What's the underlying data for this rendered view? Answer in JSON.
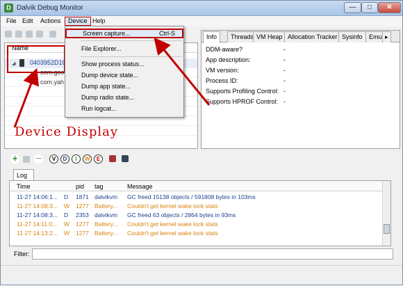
{
  "window": {
    "title": "Dalvik Debug Monitor",
    "min_glyph": "—",
    "max_glyph": "□",
    "close_glyph": "✕",
    "app_icon_glyph": "D"
  },
  "menubar": {
    "items": [
      "File",
      "Edit",
      "Actions",
      "Device",
      "Help"
    ]
  },
  "device_panel": {
    "column_header": "Name",
    "device_serial": "0403952D10",
    "expand_glyph": "◢",
    "apps": [
      "com.goo",
      "com.yah"
    ]
  },
  "device_menu": {
    "items": [
      {
        "label": "Screen capture...",
        "shortcut": "Ctrl-S"
      },
      {
        "label": "File Explorer...",
        "shortcut": ""
      },
      {
        "label": "Show process status...",
        "shortcut": ""
      },
      {
        "label": "Dump device state...",
        "shortcut": ""
      },
      {
        "label": "Dump app state...",
        "shortcut": ""
      },
      {
        "label": "Dump radio state...",
        "shortcut": ""
      },
      {
        "label": "Run logcat...",
        "shortcut": ""
      }
    ]
  },
  "info_panel": {
    "tabs": [
      "Info",
      "Threads",
      "VM Heap",
      "Allocation Tracker",
      "Sysinfo",
      "Emu"
    ],
    "properties": [
      {
        "label": "DDM-aware?",
        "value": "-"
      },
      {
        "label": "App description:",
        "value": "-"
      },
      {
        "label": "VM version:",
        "value": "-"
      },
      {
        "label": "Process ID:",
        "value": "-"
      },
      {
        "label": "Supports Profiling Control:",
        "value": "-"
      },
      {
        "label": "Supports HPROF Control:",
        "value": "-"
      }
    ]
  },
  "annotation": {
    "text": "Device Display",
    "color": "#c00000"
  },
  "log_toolbar": {
    "levels": [
      "V",
      "D",
      "I",
      "W",
      "E"
    ],
    "level_colors": [
      "#000000",
      "#1c3f8f",
      "#2a8a2a",
      "#d9820e",
      "#c00000"
    ],
    "add_glyph": "+",
    "remove_glyph": "—"
  },
  "log": {
    "tab_label": "Log",
    "columns": [
      "Time",
      "",
      "pid",
      "tag",
      "Message"
    ],
    "rows": [
      {
        "time": "11-27 14:06:1...",
        "level": "D",
        "pid": "1871",
        "tag": "dalvikvm",
        "message": "GC freed 15138 objects / 591808 bytes in 103ms",
        "color": "#1c3f8f"
      },
      {
        "time": "11-27 14:08:3...",
        "level": "W",
        "pid": "1277",
        "tag": "Battery...",
        "message": "Couldn't get kernel wake lock stats",
        "color": "#d9820e"
      },
      {
        "time": "11-27 14:08:3...",
        "level": "D",
        "pid": "2353",
        "tag": "dalvikvm",
        "message": "GC freed 63 objects / 2864 bytes in 93ms",
        "color": "#1c3f8f"
      },
      {
        "time": "11-27 14:11:0...",
        "level": "W",
        "pid": "1277",
        "tag": "Battery...",
        "message": "Couldn't get kernel wake lock stats",
        "color": "#d9820e"
      },
      {
        "time": "11-27 14:13:2...",
        "level": "W",
        "pid": "1277",
        "tag": "Battery...",
        "message": "Couldn't get kernel wake lock stats",
        "color": "#d9820e"
      }
    ]
  },
  "filter": {
    "label": "Filter:",
    "value": ""
  }
}
